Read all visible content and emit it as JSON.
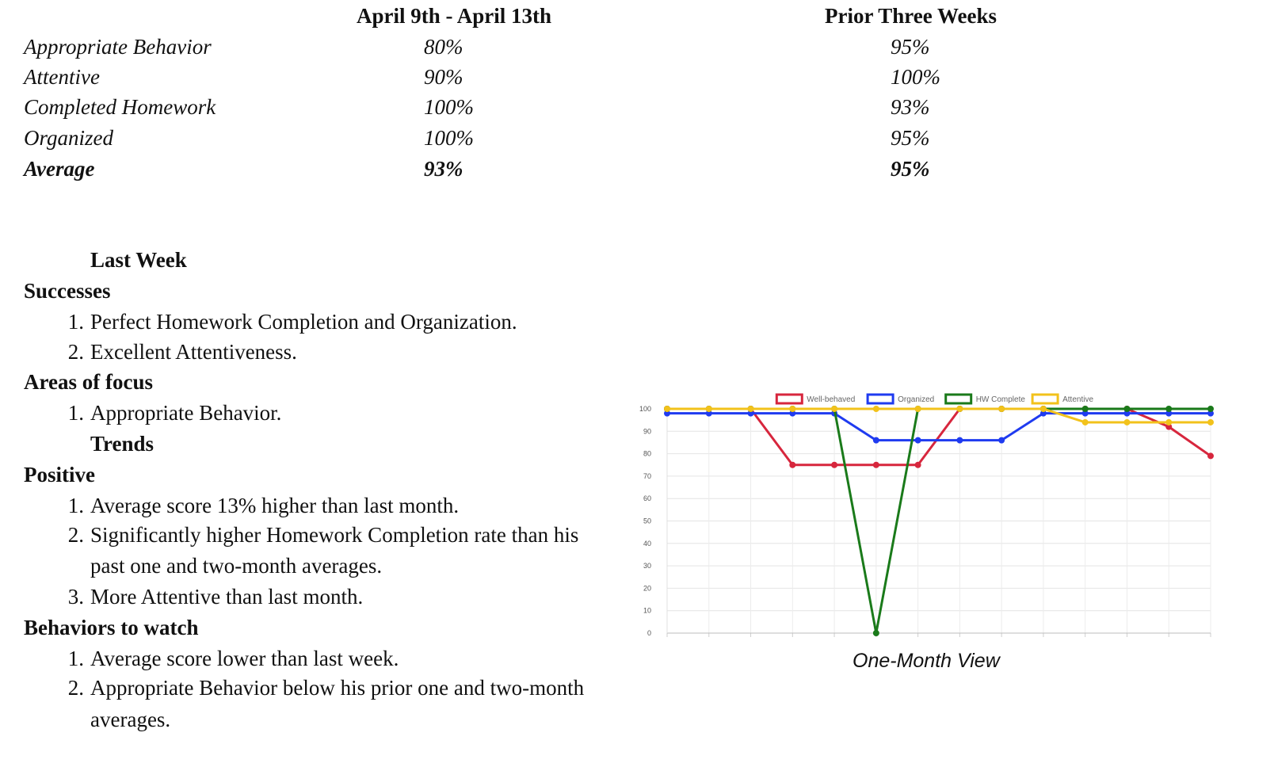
{
  "table": {
    "headers": [
      "April 9th - April 13th",
      "Prior Three Weeks"
    ],
    "rows": [
      {
        "label": "Appropriate Behavior",
        "current": "80%",
        "prior": "95%"
      },
      {
        "label": "Attentive",
        "current": "90%",
        "prior": "100%"
      },
      {
        "label": "Completed Homework",
        "current": "100%",
        "prior": "93%"
      },
      {
        "label": "Organized",
        "current": "100%",
        "prior": "95%"
      },
      {
        "label": "Average",
        "current": "93%",
        "prior": "95%"
      }
    ]
  },
  "report": {
    "last_week_heading": "Last Week",
    "successes": {
      "heading": "Successes",
      "items": [
        "Perfect Homework Completion and Organization.",
        "Excellent Attentiveness."
      ]
    },
    "areas_of_focus": {
      "heading": "Areas of focus",
      "items": [
        "Appropriate Behavior."
      ]
    },
    "trends_heading": "Trends",
    "positive": {
      "heading": "Positive",
      "items": [
        "Average score 13% higher than last month.",
        "Significantly higher Homework Completion rate than his",
        "past one and two-month averages.",
        "More Attentive than last month."
      ]
    },
    "behaviors_to_watch": {
      "heading": "Behaviors to watch",
      "items": [
        "Average score lower than last week.",
        "Appropriate Behavior below his prior one and two-month",
        "averages."
      ]
    },
    "list_numbers": [
      "1.",
      "2.",
      "3."
    ]
  },
  "chart_data": {
    "type": "line",
    "caption": "One-Month View",
    "ylim": [
      0,
      100
    ],
    "yticks": [
      0,
      10,
      20,
      30,
      40,
      50,
      60,
      70,
      80,
      90,
      100
    ],
    "legend_position": "top",
    "grid": true,
    "x": [
      1,
      2,
      3,
      4,
      5,
      6,
      7,
      8,
      9,
      10,
      11,
      12,
      13,
      14
    ],
    "series": [
      {
        "name": "Well-behaved",
        "color": "#d7263d",
        "values": [
          100,
          100,
          100,
          75,
          75,
          75,
          75,
          100,
          100,
          100,
          100,
          100,
          92,
          79
        ]
      },
      {
        "name": "Organized",
        "color": "#1f3bf0",
        "values": [
          98,
          98,
          98,
          98,
          98,
          86,
          86,
          86,
          86,
          98,
          98,
          98,
          98,
          98
        ]
      },
      {
        "name": "HW Complete",
        "color": "#1a7a1a",
        "values": [
          100,
          100,
          100,
          100,
          100,
          0,
          100,
          100,
          100,
          100,
          100,
          100,
          100,
          100
        ]
      },
      {
        "name": "Attentive",
        "color": "#f2c21b",
        "values": [
          100,
          100,
          100,
          100,
          100,
          100,
          100,
          100,
          100,
          100,
          94,
          94,
          94,
          94
        ]
      }
    ]
  }
}
